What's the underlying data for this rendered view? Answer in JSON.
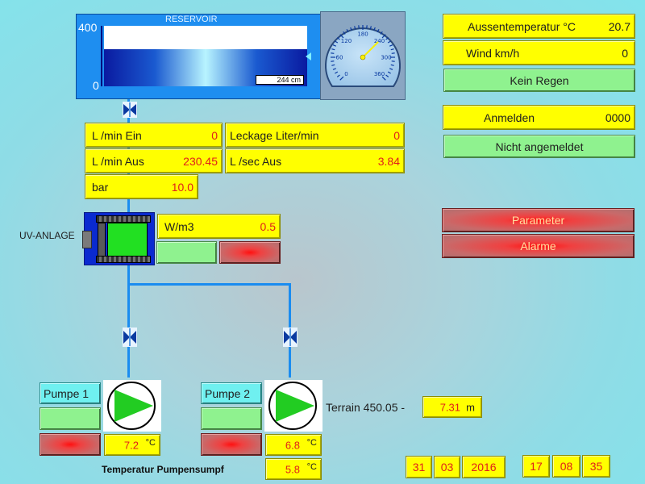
{
  "reservoir": {
    "title": "RESERVOIR",
    "max_label": "400",
    "min_label": "0",
    "level_readout": "244 cm",
    "level_fraction": 0.61
  },
  "gauge": {
    "ticks": [
      "0",
      "60",
      "120",
      "180",
      "240",
      "300",
      "360"
    ],
    "needle_value": 240
  },
  "weather": {
    "temp_label": "Aussentemperatur °C",
    "temp_value": "20.7",
    "wind_label": "Wind  km/h",
    "wind_value": "0",
    "rain_status": "Kein Regen"
  },
  "login": {
    "label": "Anmelden",
    "value": "0000",
    "status": "Nicht angemeldet"
  },
  "flow": {
    "in_label": "L /min Ein",
    "in_value": "0",
    "out_label": "L /min Aus",
    "out_value": "230.45",
    "pressure_label": "bar",
    "pressure_value": "10.0",
    "leak_label": "Leckage Liter/min",
    "leak_value": "0",
    "sec_label": "L /sec Aus",
    "sec_value": "3.84"
  },
  "uv": {
    "label": "UV-ANLAGE",
    "power_label": "W/m3",
    "power_value": "0.5"
  },
  "menu": {
    "parameter": "Parameter",
    "alarms": "Alarme"
  },
  "pumps": [
    {
      "name": "Pumpe 1",
      "temp_value": "7.2",
      "unit": "°C"
    },
    {
      "name": "Pumpe 2",
      "temp_value": "6.8",
      "unit": "°C"
    }
  ],
  "sump": {
    "label": "Temperatur Pumpensumpf",
    "temp_value": "5.8",
    "unit": "°C"
  },
  "terrain": {
    "label": "Terrain 450.05 -",
    "value": "7.31",
    "unit": "m"
  },
  "date": {
    "day": "31",
    "month": "03",
    "year": "2016"
  },
  "time": {
    "hour": "17",
    "minute": "08",
    "second": "35"
  },
  "colors": {
    "pipe": "#1a8cf0",
    "field_yellow": "#ffff00",
    "value_red": "#e0201a",
    "status_green": "#8ff28f",
    "pump_green": "#22cc22",
    "alarm_red": "#ff1010"
  }
}
